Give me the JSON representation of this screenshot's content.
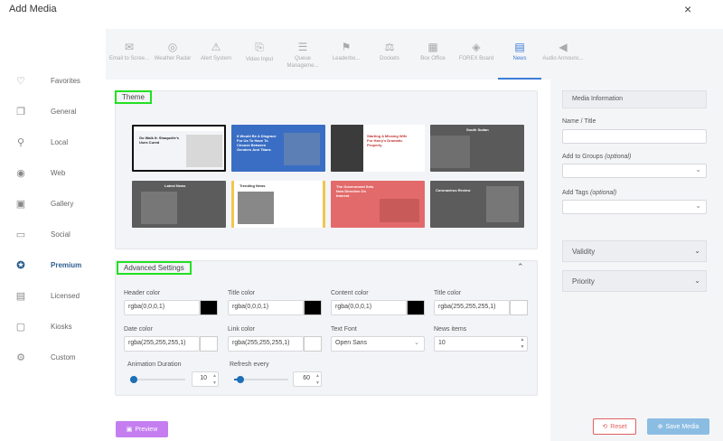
{
  "title": "Add Media",
  "close_icon": "×",
  "sidebar": {
    "items": [
      {
        "label": "Favorites",
        "icon": "♡"
      },
      {
        "label": "General",
        "icon": "❐"
      },
      {
        "label": "Local",
        "icon": "⚲"
      },
      {
        "label": "Web",
        "icon": "◉"
      },
      {
        "label": "Gallery",
        "icon": "▣"
      },
      {
        "label": "Social",
        "icon": "▭"
      },
      {
        "label": "Premium",
        "icon": "✪"
      },
      {
        "label": "Licensed",
        "icon": "▤"
      },
      {
        "label": "Kiosks",
        "icon": "▢"
      },
      {
        "label": "Custom",
        "icon": "⚙"
      }
    ]
  },
  "toolbar": {
    "items": [
      {
        "label": "Email to Scree...",
        "icon": "✉"
      },
      {
        "label": "Weather Radar",
        "icon": "◎"
      },
      {
        "label": "Alert System",
        "icon": "⚠"
      },
      {
        "label": "Video Input",
        "icon": "⎘"
      },
      {
        "label": "Queue Manageme...",
        "icon": "☰"
      },
      {
        "label": "Leaderbo...",
        "icon": "⚑"
      },
      {
        "label": "Dockets",
        "icon": "⚖"
      },
      {
        "label": "Box Office",
        "icon": "▦"
      },
      {
        "label": "FOREX Board",
        "icon": "◈"
      },
      {
        "label": "News",
        "icon": "▤"
      },
      {
        "label": "Audio Announc...",
        "icon": "◀"
      }
    ]
  },
  "theme": {
    "heading": "Theme",
    "thumbs": [
      {
        "headline": "Go Walk It: Shaquelle's Uses Cured",
        "accent": "#ffffff",
        "bg": "#ffffff",
        "text": "#222222"
      },
      {
        "headline": "It Would Be A Disgrace For Us To Have To Choose Between Genders And Titans",
        "accent": "#3a6ec4",
        "bg": "#3a6ec4",
        "text": "#ffffff"
      },
      {
        "headline": "Starting A Missing Wife For Harry's Dramatic Property",
        "accent": "#3b3b3b",
        "bg": "#ffffff",
        "text": "#c33333"
      },
      {
        "headline": "South Sudan",
        "accent": "#555555",
        "bg": "#5a5a5a",
        "text": "#ffffff"
      },
      {
        "headline": "Latest News",
        "accent": "#555555",
        "bg": "#5c5c5c",
        "text": "#ffffff"
      },
      {
        "headline": "Trending News",
        "accent": "#f3c64f",
        "bg": "#ffffff",
        "text": "#333333"
      },
      {
        "headline": "The Government Sets New Directive On Interest",
        "accent": "#e45b5b",
        "bg": "#e36a6a",
        "text": "#ffffff"
      },
      {
        "headline": "Coronavirus Review",
        "accent": "#e05b5b",
        "bg": "#5c5c5c",
        "text": "#ffffff"
      }
    ]
  },
  "advanced": {
    "heading": "Advanced Settings",
    "header_color_label": "Header color",
    "header_color_value": "rgba(0,0,0,1)",
    "title_color_label": "Title color",
    "title_color_value": "rgba(0,0,0,1)",
    "content_color_label": "Content color",
    "content_color_value": "rgba(0,0,0,1)",
    "title_color2_label": "Title color",
    "title_color2_value": "rgba(255,255,255,1)",
    "date_color_label": "Date color",
    "date_color_value": "rgba(255,255,255,1)",
    "link_color_label": "Link color",
    "link_color_value": "rgba(255,255,255,1)",
    "text_font_label": "Text Font",
    "text_font_value": "Open Sans",
    "news_items_label": "News items",
    "news_items_value": "10",
    "animation_label": "Animation Duration",
    "animation_value": "10",
    "animation_fraction": 0.05,
    "refresh_label": "Refresh every",
    "refresh_value": "60",
    "refresh_fraction": 0.12
  },
  "preview_label": "Preview",
  "right": {
    "heading": "Media Information",
    "name_label": "Name / Title",
    "groups_label": "Add to Groups",
    "groups_optional": "(optional)",
    "tags_label": "Add Tags",
    "tags_optional": "(optional)",
    "validity_label": "Validity",
    "priority_label": "Priority",
    "reset_label": "Reset",
    "save_label": "Save Media"
  },
  "colors": {
    "accent": "#3b7dd8",
    "highlight": "#22e022",
    "preview": "#c47ef0",
    "save": "#8bbde3",
    "reset": "#e06060"
  }
}
